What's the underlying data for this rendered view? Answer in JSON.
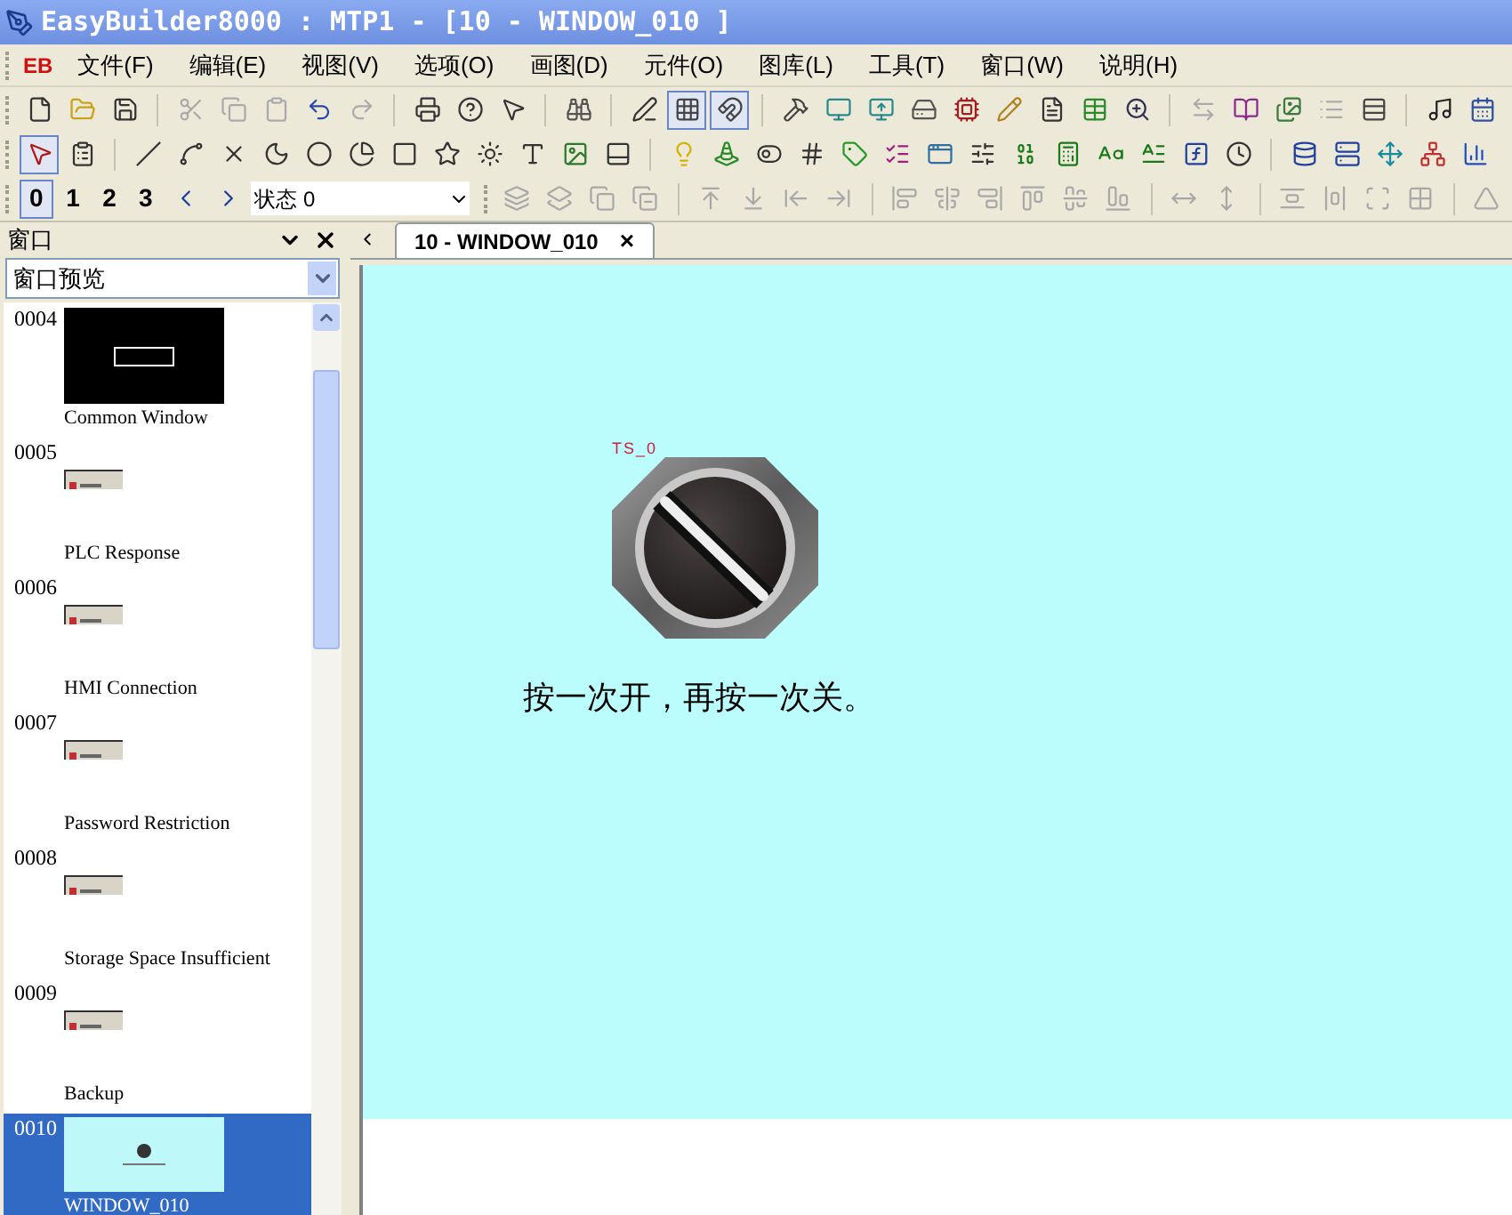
{
  "window": {
    "title": "EasyBuilder8000 : MTP1 - [10 - WINDOW_010 ]"
  },
  "menu": {
    "logo": "EB",
    "items": [
      {
        "label": "文件(F)"
      },
      {
        "label": "编辑(E)"
      },
      {
        "label": "视图(V)"
      },
      {
        "label": "选项(O)"
      },
      {
        "label": "画图(D)"
      },
      {
        "label": "元件(O)"
      },
      {
        "label": "图库(L)"
      },
      {
        "label": "工具(T)"
      },
      {
        "label": "窗口(W)"
      },
      {
        "label": "说明(H)"
      }
    ]
  },
  "toolbar": {
    "grid_toggle": {
      "on": true
    },
    "snap_toggle": {
      "on": true
    },
    "select_tool": {
      "on": true
    }
  },
  "layers": [
    {
      "label": "0",
      "selected": true
    },
    {
      "label": "1",
      "selected": false
    },
    {
      "label": "2",
      "selected": false
    },
    {
      "label": "3",
      "selected": false
    }
  ],
  "state_select": {
    "value": "状态 0"
  },
  "left_panel": {
    "title": "窗口",
    "view_select": {
      "value": "窗口预览"
    },
    "windows": [
      {
        "number": "0004",
        "name": "Common Window",
        "kind": "dark",
        "selected": false
      },
      {
        "number": "0005",
        "name": "PLC Response",
        "kind": "dialog",
        "selected": false
      },
      {
        "number": "0006",
        "name": "HMI Connection",
        "kind": "dialog",
        "selected": false
      },
      {
        "number": "0007",
        "name": "Password Restriction",
        "kind": "dialog",
        "selected": false
      },
      {
        "number": "0008",
        "name": "Storage Space Insufficient",
        "kind": "dialog",
        "selected": false
      },
      {
        "number": "0009",
        "name": "Backup",
        "kind": "dialog",
        "selected": false
      },
      {
        "number": "0010",
        "name": "WINDOW_010",
        "kind": "cyan",
        "selected": true
      }
    ]
  },
  "editor": {
    "switch": {
      "on": false
    },
    "tab": {
      "label": "10 - WINDOW_010",
      "close": "×",
      "selected": true
    },
    "object_label": "TS_0",
    "caption": "按一次开，再按一次关。"
  }
}
